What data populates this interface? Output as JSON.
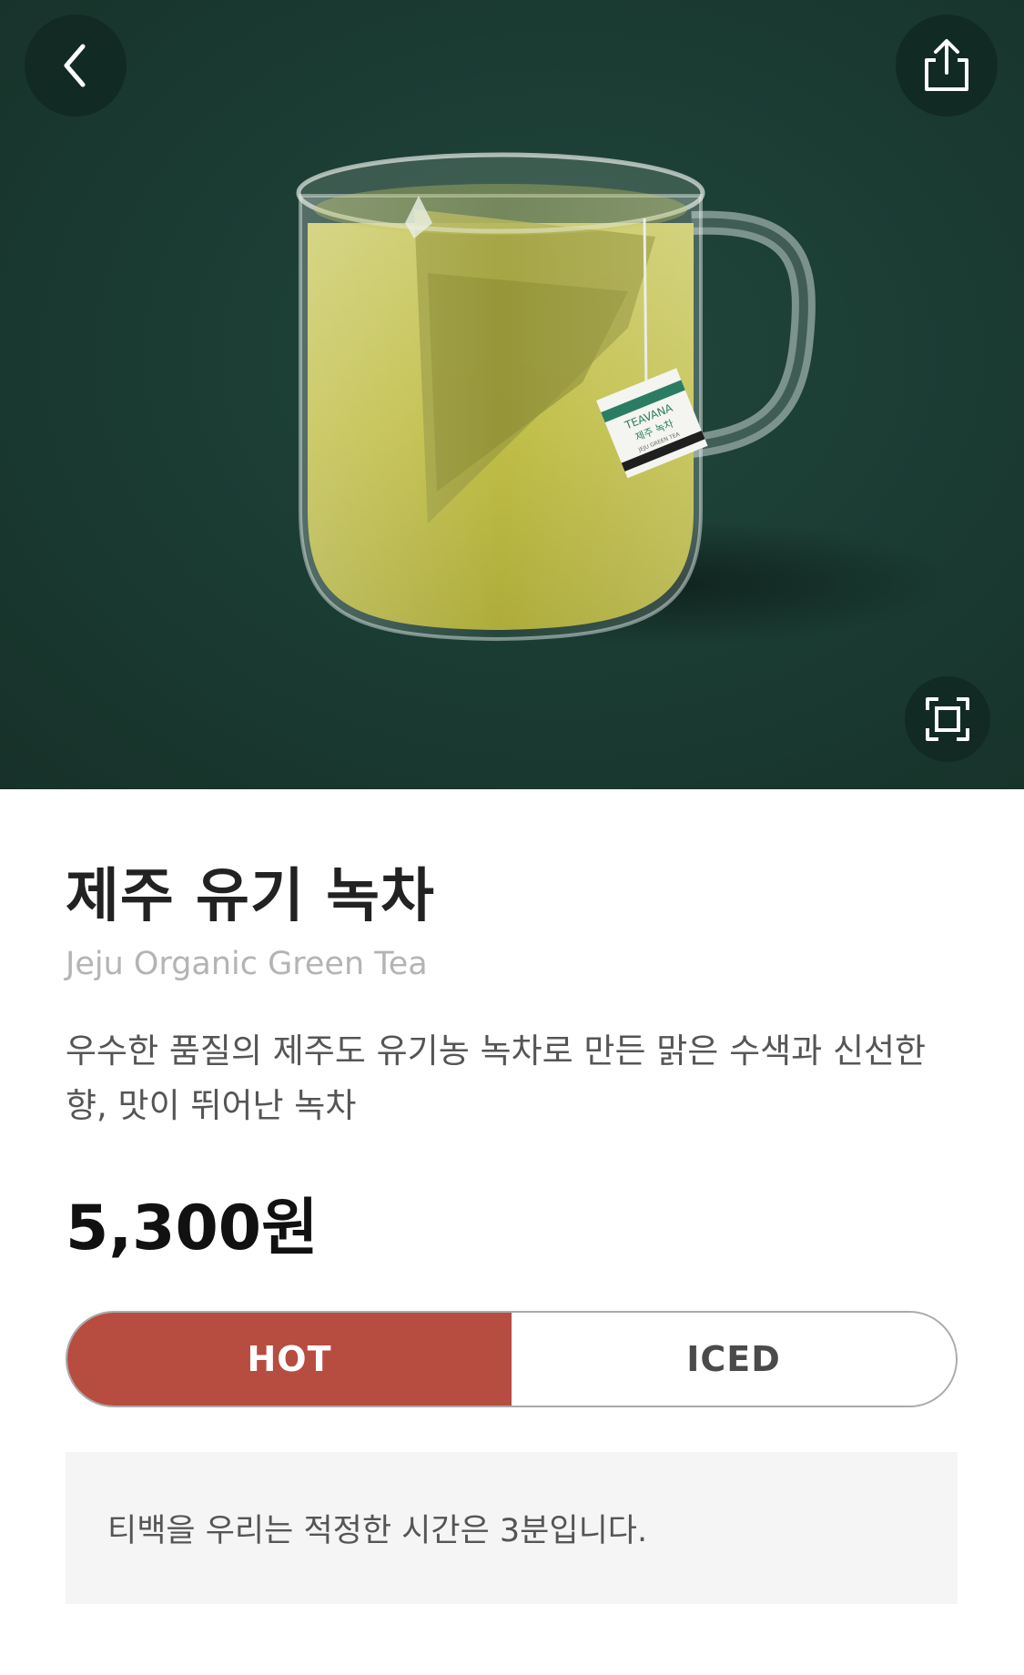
{
  "hero": {
    "image_alt": "product-photo",
    "tea_tag": {
      "brand": "TEAVANA",
      "name_kr": "제주 녹차",
      "name_en": "JEJU GREEN TEA"
    }
  },
  "nav": {
    "back_icon": "chevron-left-icon",
    "share_icon": "share-icon",
    "expand_icon": "expand-icon"
  },
  "product": {
    "title": "제주 유기 녹차",
    "subtitle": "Jeju Organic Green Tea",
    "description": "우수한 품질의 제주도 유기농 녹차로 만든 맑은 수색과 신선한 향, 맛이 뛰어난 녹차",
    "price": "5,300원"
  },
  "temperature": {
    "options": [
      "HOT",
      "ICED"
    ],
    "selected": "HOT",
    "selected_color": "#b74c40"
  },
  "notice": {
    "text": "티백을 우리는 적정한 시간은 3분입니다."
  },
  "colors": {
    "hero_bg": "#1a3b32",
    "accent": "#b74c40"
  }
}
